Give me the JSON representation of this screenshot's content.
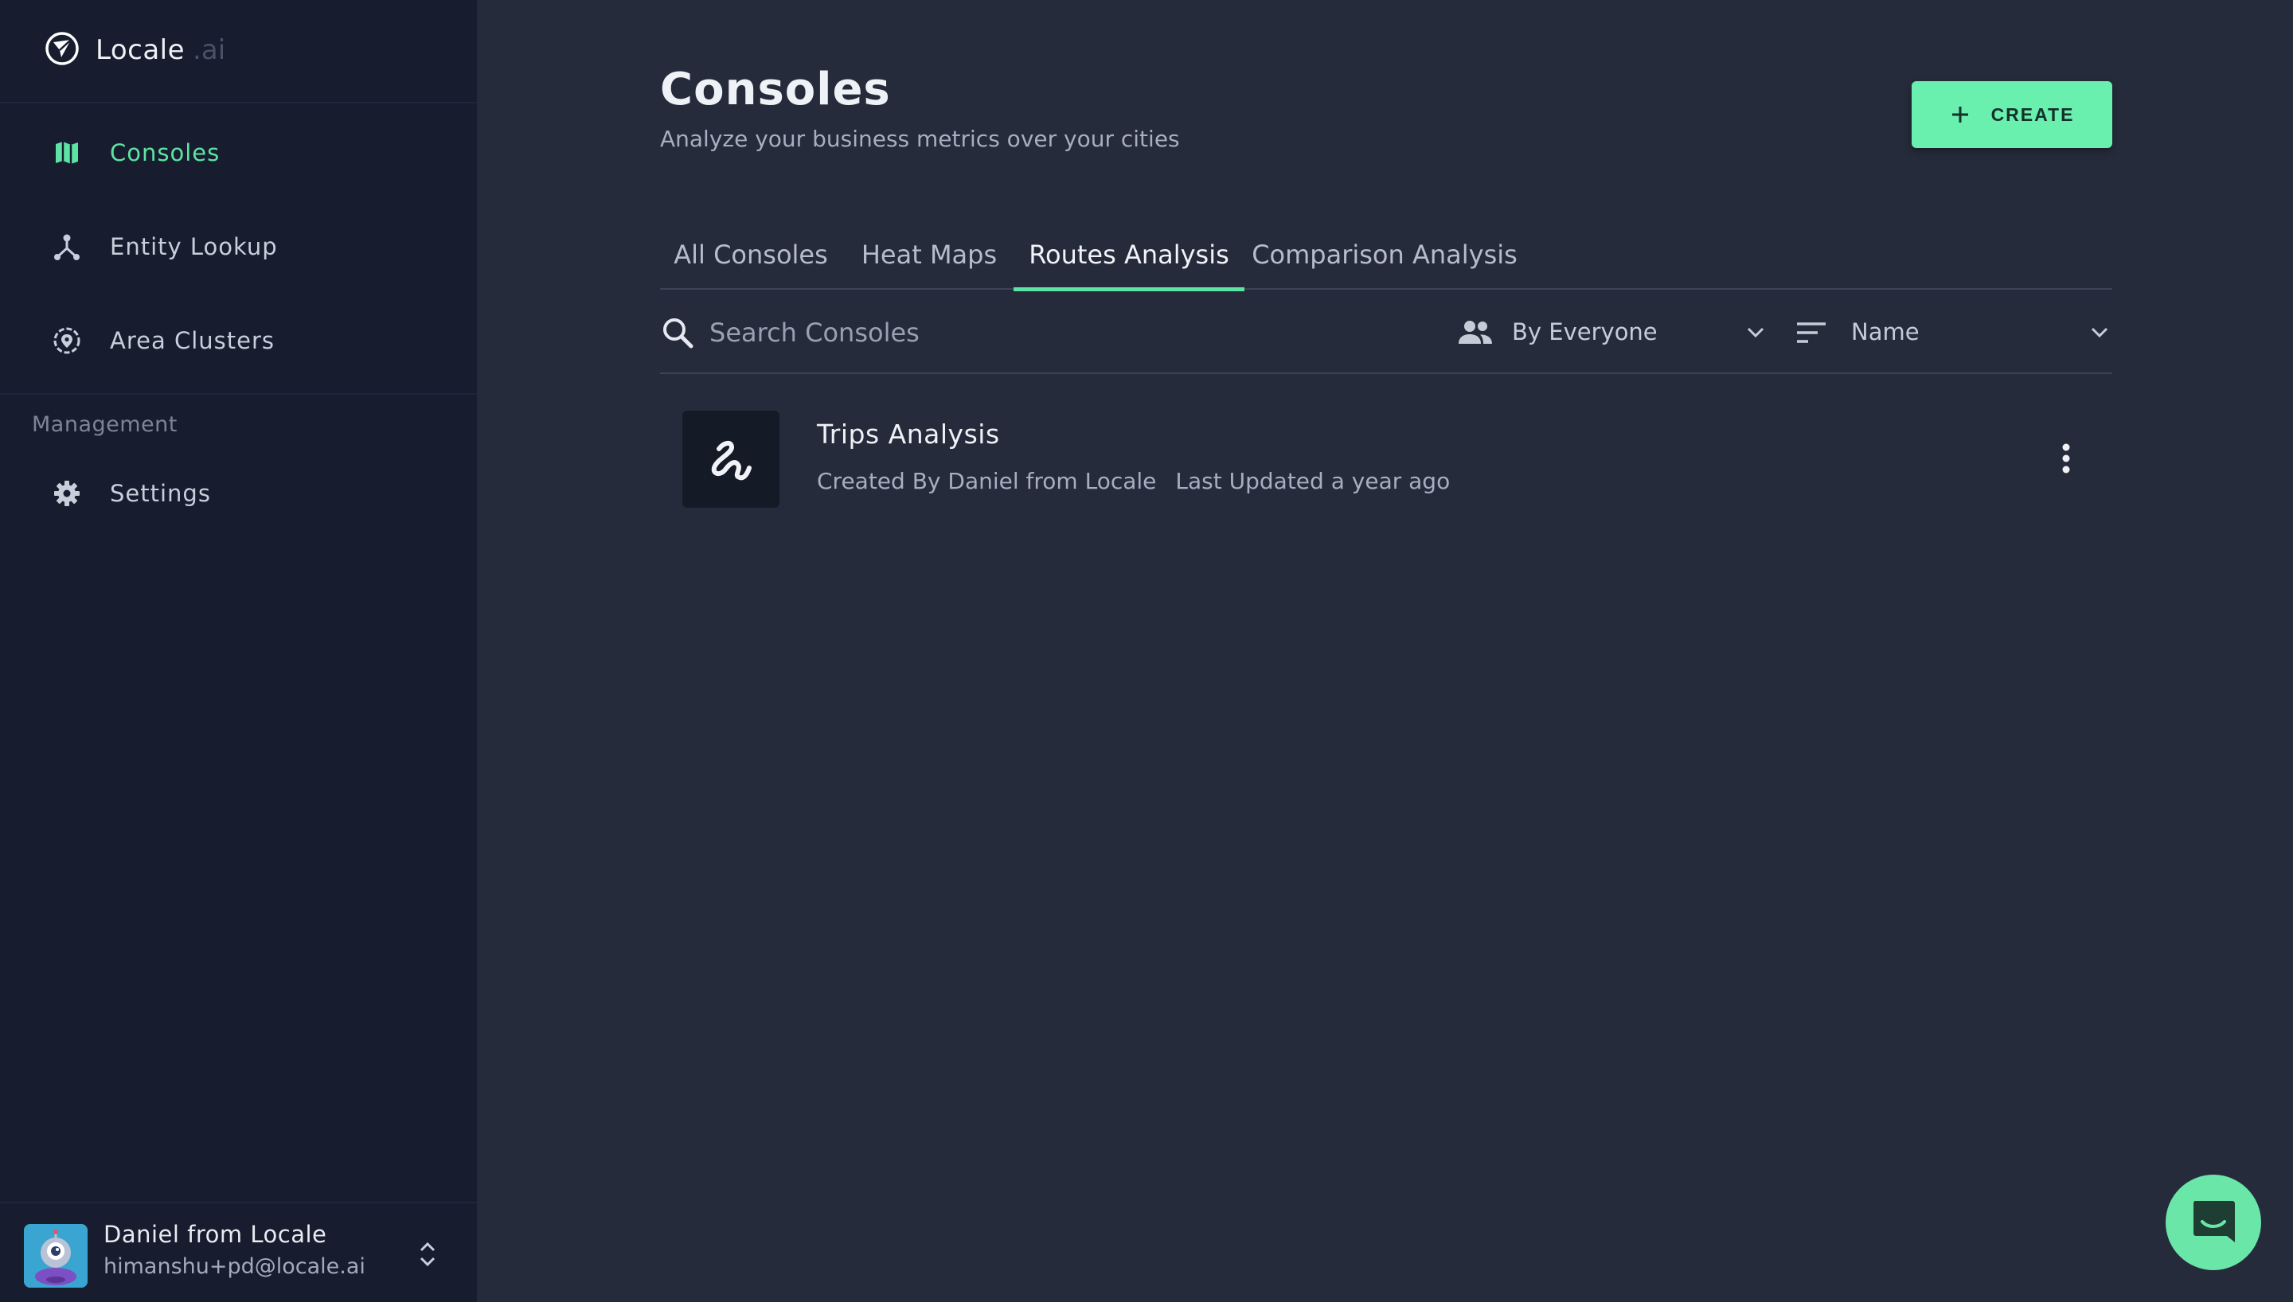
{
  "brand": {
    "name": "Locale",
    "suffix": ".ai"
  },
  "sidebar": {
    "items": [
      {
        "label": "Consoles",
        "icon": "map-icon",
        "active": true
      },
      {
        "label": "Entity Lookup",
        "icon": "network-icon",
        "active": false
      },
      {
        "label": "Area Clusters",
        "icon": "location-target-icon",
        "active": false
      }
    ],
    "section_label": "Management",
    "management_items": [
      {
        "label": "Settings",
        "icon": "gear-icon"
      }
    ]
  },
  "user": {
    "name": "Daniel from Locale",
    "email": "himanshu+pd@locale.ai"
  },
  "header": {
    "title": "Consoles",
    "subtitle": "Analyze your business metrics over your cities",
    "create_label": "CREATE"
  },
  "tabs": [
    {
      "label": "All Consoles",
      "active": false
    },
    {
      "label": "Heat Maps",
      "active": false
    },
    {
      "label": "Routes Analysis",
      "active": true
    },
    {
      "label": "Comparison Analysis",
      "active": false
    }
  ],
  "filters": {
    "search_placeholder": "Search Consoles",
    "owner_value": "By Everyone",
    "sort_value": "Name"
  },
  "consoles": [
    {
      "title": "Trips Analysis",
      "created_by": "Created By Daniel from Locale",
      "updated": "Last Updated a year ago",
      "icon": "route-squiggle-icon"
    }
  ],
  "colors": {
    "accent": "#5de4a4",
    "button": "#6af0ae",
    "sidebar_bg": "#171d2e",
    "main_bg": "#262b3b"
  }
}
